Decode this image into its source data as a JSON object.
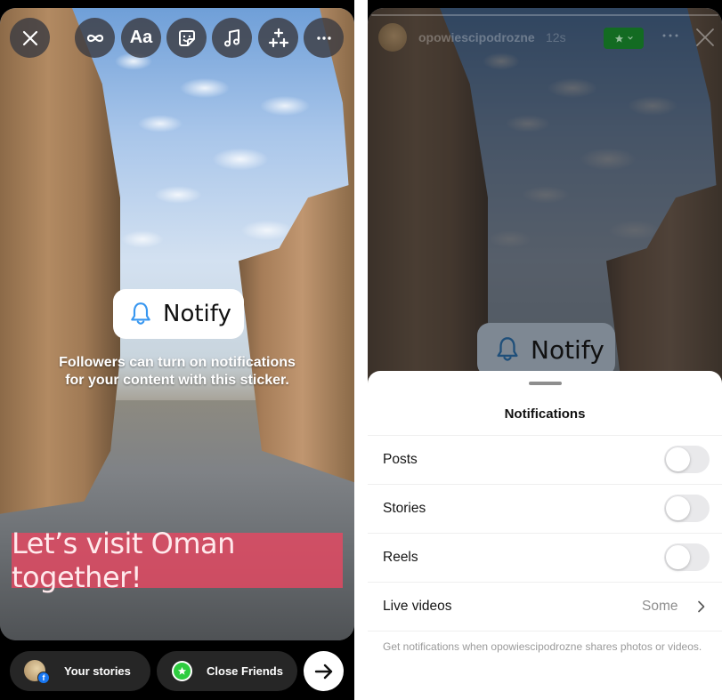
{
  "left_screen": {
    "toolbar": {
      "close_icon": "close-icon",
      "tools": [
        {
          "name": "boomerang",
          "icon": "infinity-icon"
        },
        {
          "name": "text",
          "label": "Aa",
          "icon": "text-icon"
        },
        {
          "name": "sticker",
          "icon": "sticker-icon"
        },
        {
          "name": "music",
          "icon": "music-note-icon"
        },
        {
          "name": "effects",
          "icon": "sparkles-icon"
        }
      ],
      "more_icon": "more-horizontal-icon"
    },
    "notify_sticker": {
      "icon": "bell-icon",
      "label": "Notify",
      "hint_line1": "Followers can turn on notifications",
      "hint_line2": "for your content with this sticker."
    },
    "caption": "Let’s visit Oman together!",
    "share_bar": {
      "your_stories": "Your stories",
      "close_friends": "Close Friends",
      "next_icon": "arrow-right-icon"
    },
    "colors": {
      "caption_bg": "#e54861",
      "close_friends_green": "#2ecc40",
      "bell_blue": "#3897f0"
    }
  },
  "right_screen": {
    "header": {
      "username": "opowiescipodrozne",
      "time": "12s",
      "close_friends_badge_icon": "star-icon",
      "more_icon": "more-horizontal-icon",
      "close_icon": "close-icon"
    },
    "notify_sticker": {
      "label": "Notify"
    },
    "sheet": {
      "title": "Notifications",
      "rows": [
        {
          "label": "Posts",
          "type": "toggle",
          "on": false
        },
        {
          "label": "Stories",
          "type": "toggle",
          "on": false
        },
        {
          "label": "Reels",
          "type": "toggle",
          "on": false
        },
        {
          "label": "Live videos",
          "type": "select",
          "value": "Some"
        }
      ],
      "footnote": "Get notifications when opowiescipodrozne shares photos or videos."
    }
  }
}
